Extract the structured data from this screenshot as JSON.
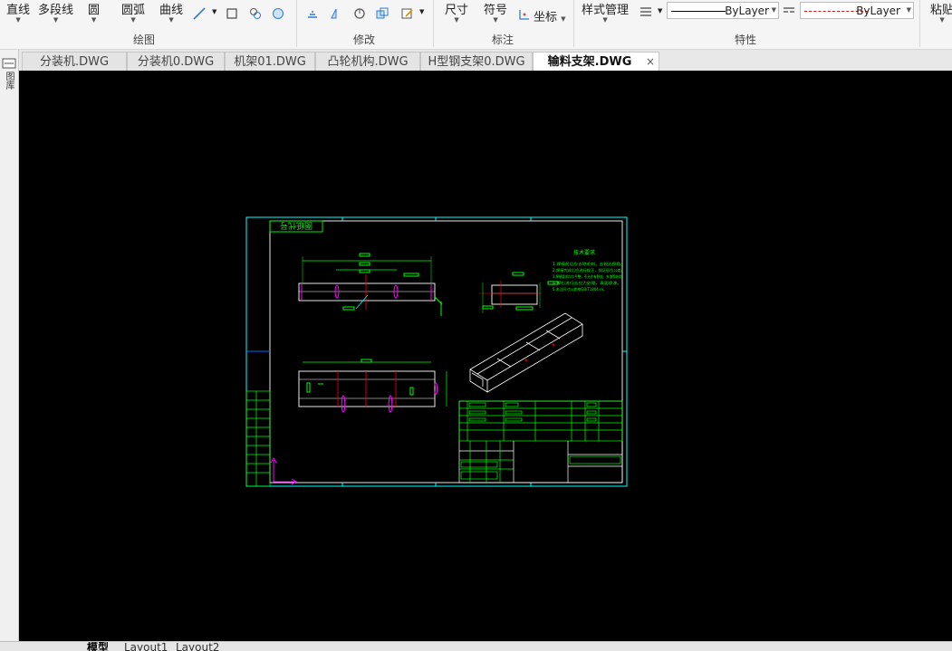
{
  "ribbon": {
    "draw": {
      "line": "直线",
      "polyline": "多段线",
      "circle": "圆",
      "arc": "圆弧",
      "curve": "曲线",
      "group": "绘图"
    },
    "modify": {
      "group": "修改"
    },
    "annotate": {
      "dimension": "尺寸",
      "symbol": "符号",
      "coordinate": "坐标",
      "group": "标注"
    },
    "properties": {
      "style_manager": "样式管理",
      "linetype1": "ByLayer",
      "linetype2": "ByLayer",
      "group": "特性"
    },
    "clipboard": {
      "paste": "粘贴"
    }
  },
  "tabs": [
    {
      "label": "分装机.DWG"
    },
    {
      "label": "分装机0.DWG"
    },
    {
      "label": "机架01.DWG"
    },
    {
      "label": "凸轮机构.DWG"
    },
    {
      "label": "H型钢支架0.DWG"
    },
    {
      "label": "输料支架.DWG",
      "active": true
    }
  ],
  "close_glyph": "×",
  "left_strip": {
    "label1": "图库"
  },
  "bottom_tabs": [
    {
      "label": "模型",
      "active": true
    },
    {
      "label": "Layout1"
    },
    {
      "label": "Layout2"
    }
  ],
  "drawing": {
    "title_box_text": "图纸代号",
    "tech_req_title": "技术要求",
    "tech_req_lines": [
      "1.焊接前后应去除毛刺，去锐边倒角。",
      "2.焊接完成后应进行校正，保证形位公差。",
      "3.焊缝要求均匀平整，不允许有裂纹、夹渣等缺陷。",
      "4.焊后进行去应力处理，表面喷漆。",
      "5.未注尺寸公差按GB/T1804-m。"
    ]
  },
  "colors": {
    "canvas_bg": "#000000",
    "border": "#00ffff",
    "frame": "#ffffff",
    "dim": "#00ff00",
    "center": "#ff0000",
    "hole": "#ff00ff",
    "accent": "#00ffff"
  }
}
